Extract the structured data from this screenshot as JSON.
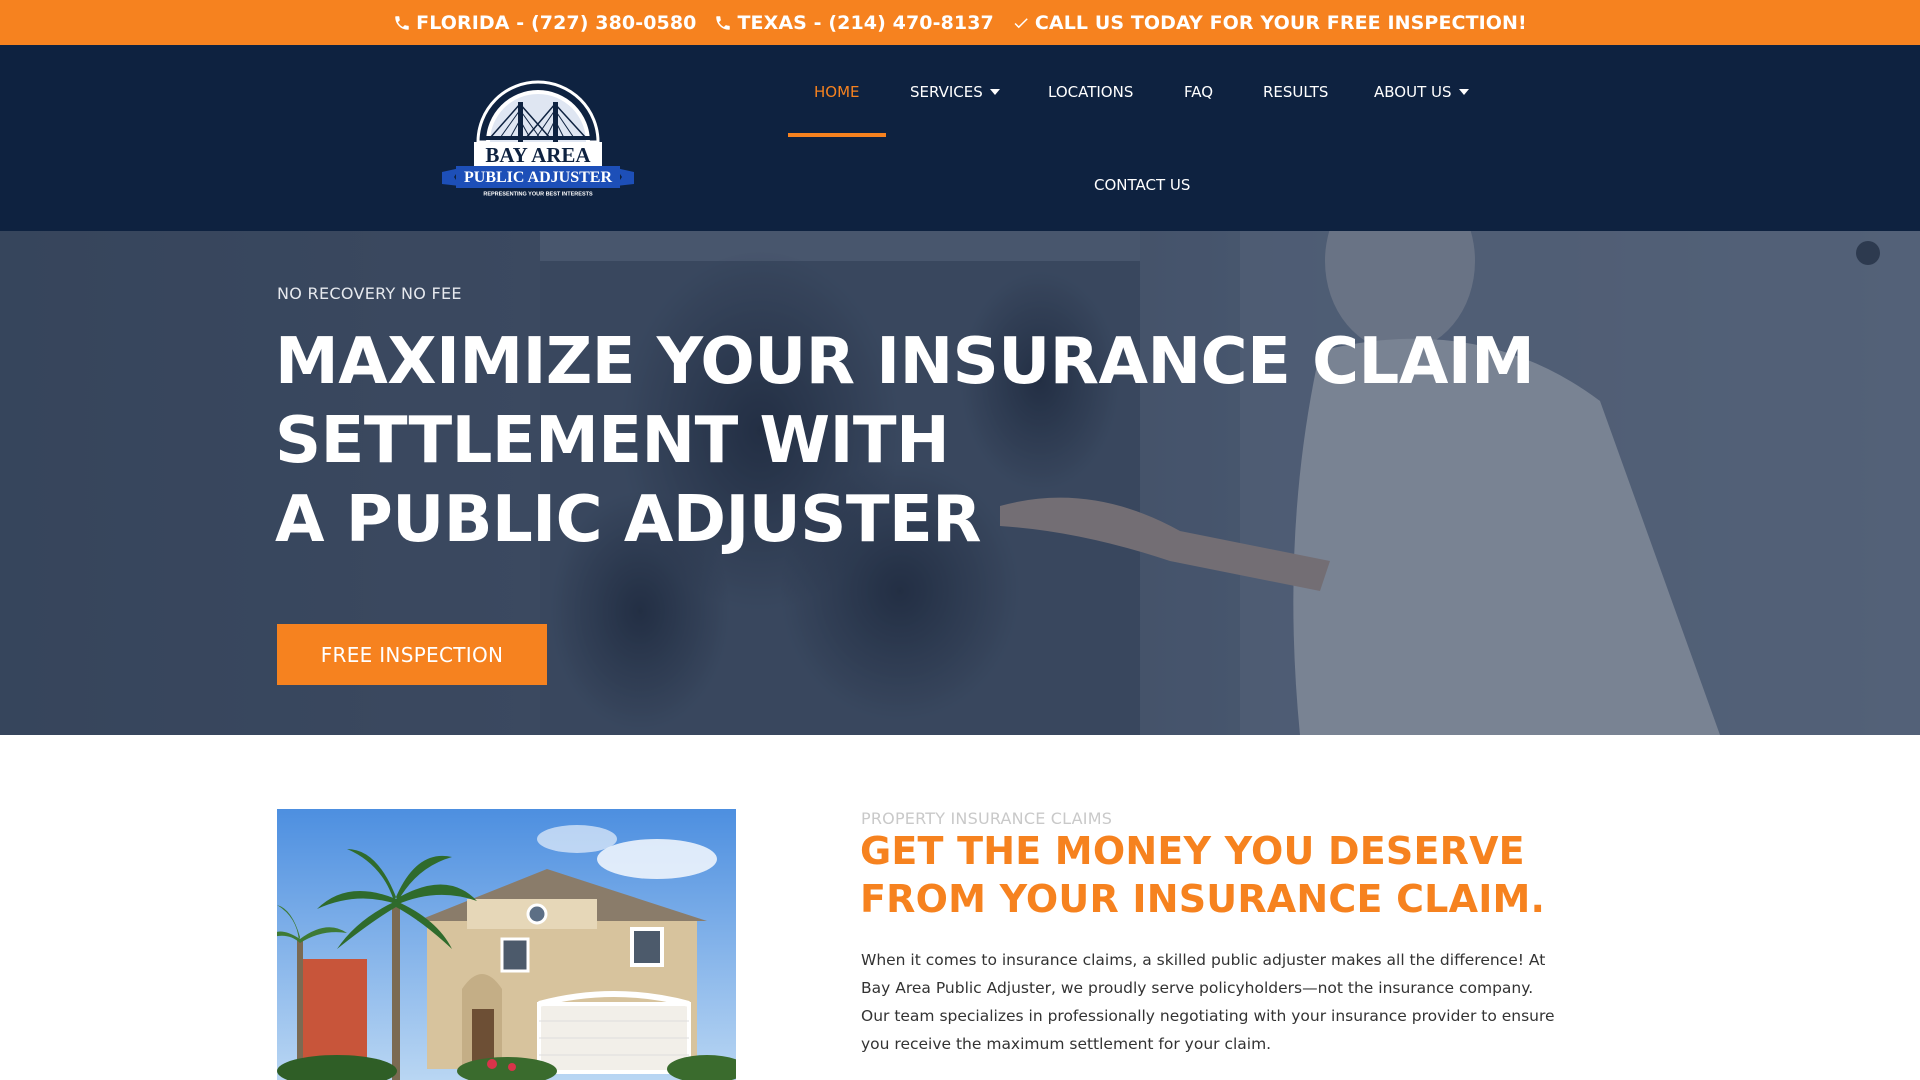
{
  "topbar": {
    "florida": "FLORIDA - (727) 380-0580",
    "texas": "TEXAS - (214) 470-8137",
    "cta": "CALL US TODAY FOR YOUR FREE INSPECTION!",
    "icons": [
      "phone-icon",
      "phone-icon",
      "check-icon"
    ]
  },
  "logo": {
    "line1": "BAY AREA",
    "line2": "PUBLIC ADJUSTER",
    "tagline": "REPRESENTING YOUR BEST INTERESTS"
  },
  "nav": {
    "items": [
      {
        "label": "HOME",
        "active": true
      },
      {
        "label": "SERVICES",
        "dropdown": true
      },
      {
        "label": "LOCATIONS"
      },
      {
        "label": "FAQ"
      },
      {
        "label": "RESULTS"
      },
      {
        "label": "ABOUT US",
        "dropdown": true
      },
      {
        "label": "CONTACT US"
      }
    ]
  },
  "hero": {
    "eyebrow": "NO RECOVERY NO FEE",
    "title_lines": [
      "MAXIMIZE YOUR INSURANCE CLAIM",
      "SETTLEMENT WITH",
      "A PUBLIC ADJUSTER"
    ],
    "cta": "FREE INSPECTION"
  },
  "section": {
    "kicker": "PROPERTY INSURANCE CLAIMS",
    "title_lines": [
      "GET THE MONEY YOU DESERVE",
      "FROM YOUR INSURANCE CLAIM."
    ],
    "body": "When it comes to insurance claims, a skilled public adjuster makes all the difference! At Bay Area Public Adjuster, we proudly serve policyholders—not the insurance company. Our team specializes in professionally negotiating with your insurance provider to ensure you receive the maximum settlement for your claim."
  },
  "colors": {
    "accent": "#f6821f",
    "navy": "#0e2240",
    "logo_blue": "#1d4fb8"
  }
}
